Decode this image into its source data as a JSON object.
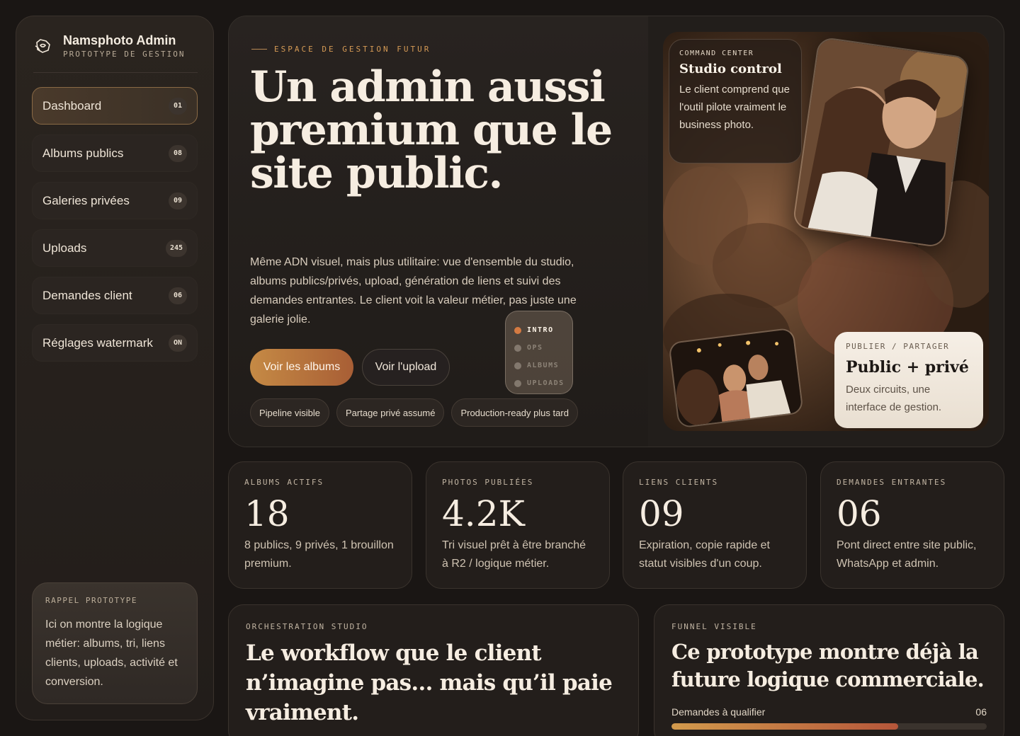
{
  "brand": {
    "name": "Namsphoto Admin",
    "subtitle": "PROTOTYPE DE GESTION",
    "icon": "camera-icon"
  },
  "nav": [
    {
      "label": "Dashboard",
      "badge": "01",
      "active": true
    },
    {
      "label": "Albums publics",
      "badge": "08"
    },
    {
      "label": "Galeries privées",
      "badge": "09"
    },
    {
      "label": "Uploads",
      "badge": "245"
    },
    {
      "label": "Demandes client",
      "badge": "06"
    },
    {
      "label": "Réglages watermark",
      "badge": "ON"
    }
  ],
  "reminder": {
    "label": "RAPPEL PROTOTYPE",
    "text": "Ici on montre la logique métier: albums, tri, liens clients, uploads, activité et conversion."
  },
  "hero": {
    "eyebrow": "ESPACE DE GESTION FUTUR",
    "title": "Un admin aussi premium que le site public.",
    "description": "Même ADN visuel, mais plus utilitaire: vue d'ensemble du studio, albums publics/privés, upload, génération de liens et suivi des demandes entrantes. Le client voit la valeur métier, pas juste une galerie jolie.",
    "primary_button": "Voir les albums",
    "secondary_button": "Voir l'upload",
    "chips": [
      "Pipeline visible",
      "Partage privé assumé",
      "Production-ready plus tard"
    ]
  },
  "command_card": {
    "label": "COMMAND CENTER",
    "title": "Studio control",
    "text": "Le client comprend que l'outil pilote vraiment le business photo."
  },
  "publish_card": {
    "label": "PUBLIER / PARTAGER",
    "title": "Public + privé",
    "text": "Deux circuits, une interface de gestion."
  },
  "steps": [
    {
      "label": "INTRO",
      "active": true
    },
    {
      "label": "OPS"
    },
    {
      "label": "ALBUMS"
    },
    {
      "label": "UPLOADS"
    }
  ],
  "stats": [
    {
      "label": "ALBUMS ACTIFS",
      "value": "18",
      "desc": "8 publics, 9 privés, 1 brouillon premium."
    },
    {
      "label": "PHOTOS PUBLIÉES",
      "value": "4.2K",
      "desc": "Tri visuel prêt à être branché à R2 / logique métier."
    },
    {
      "label": "LIENS CLIENTS",
      "value": "09",
      "desc": "Expiration, copie rapide et statut visibles d'un coup."
    },
    {
      "label": "DEMANDES ENTRANTES",
      "value": "06",
      "desc": "Pont direct entre site public, WhatsApp et admin."
    }
  ],
  "orchestration": {
    "label": "ORCHESTRATION STUDIO",
    "title": "Le workflow que le client n’imagine pas… mais qu’il paie vraiment."
  },
  "funnel": {
    "label": "FUNNEL VISIBLE",
    "title": "Ce prototype montre déjà la future logique commerciale.",
    "row_label": "Demandes à qualifier",
    "row_value": "06",
    "progress": 0.72
  },
  "colors": {
    "accent": "#c58a45",
    "accent2": "#a85e35",
    "bg": "#1a1614"
  }
}
